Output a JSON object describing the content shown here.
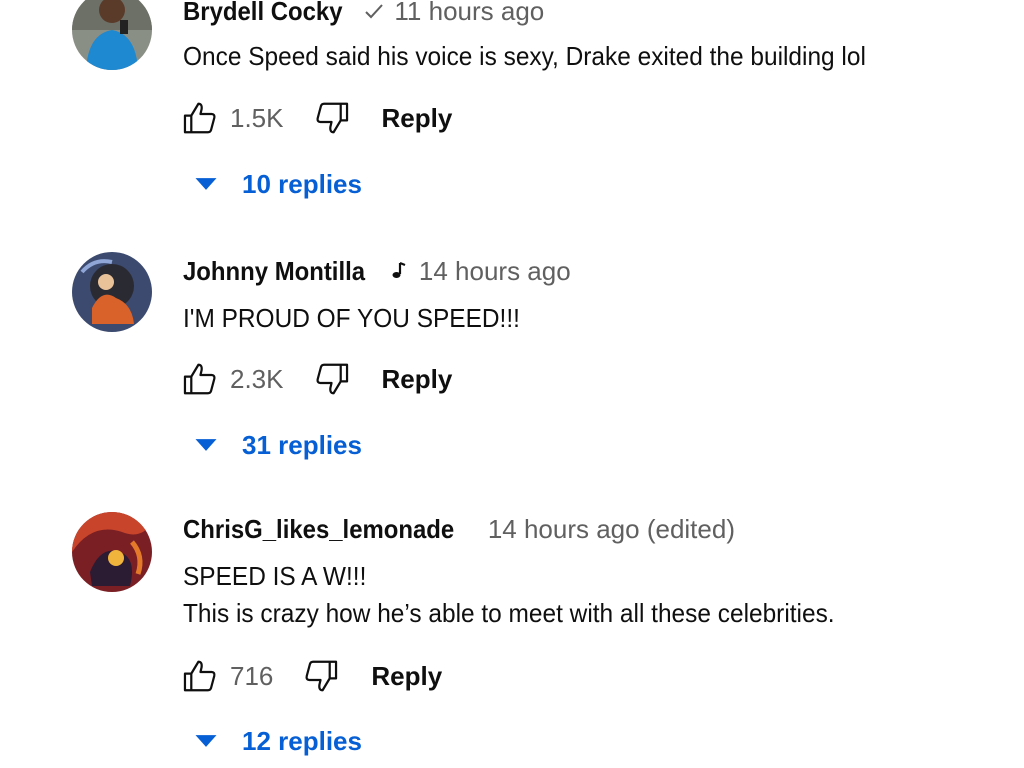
{
  "comments": [
    {
      "author": "Brydell Cocky",
      "badge": "verified-check-icon",
      "time": "11 hours ago",
      "lines": [
        "Once Speed said his voice is sexy, Drake exited the building lol"
      ],
      "likes": "1.5K",
      "reply_label": "Reply",
      "replies_label": "10 replies"
    },
    {
      "author": "Johnny Montilla",
      "badge": "music-note-icon",
      "time": "14 hours ago",
      "lines": [
        "I'M PROUD OF YOU SPEED!!!"
      ],
      "likes": "2.3K",
      "reply_label": "Reply",
      "replies_label": "31 replies"
    },
    {
      "author": "ChrisG_likes_lemonade",
      "time": "14 hours ago (edited)",
      "lines": [
        "SPEED IS A W!!!",
        "This is crazy how he’s able to meet with all these celebrities."
      ],
      "likes": "716",
      "reply_label": "Reply",
      "replies_label": "12 replies"
    }
  ],
  "colors": {
    "text": "#0f0f0f",
    "secondary": "#606060",
    "link": "#065fd4"
  }
}
